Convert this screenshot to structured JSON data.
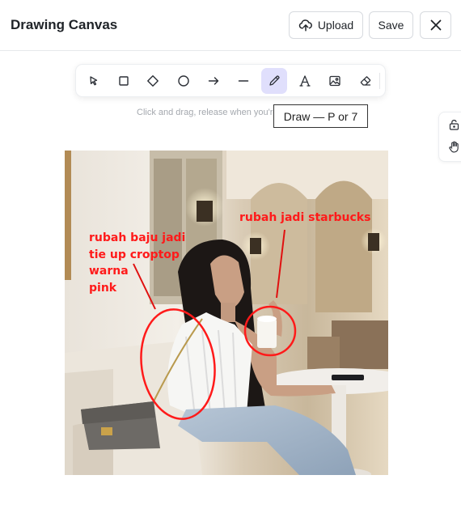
{
  "header": {
    "title": "Drawing Canvas",
    "upload_label": "Upload",
    "save_label": "Save",
    "close_icon": "close-icon"
  },
  "toolbar": {
    "tools": [
      "selection",
      "rectangle",
      "diamond",
      "ellipse",
      "arrow",
      "line",
      "draw",
      "text",
      "image",
      "eraser"
    ],
    "active_tool": "draw",
    "active_color": "#e0dffc"
  },
  "hint": "Click and drag, release when you're finished",
  "tooltip": "Draw — P or 7",
  "side_controls": [
    "lock-icon",
    "hand-icon"
  ],
  "canvas": {
    "annotation_color": "#ff1a1a",
    "annotations": [
      {
        "lines": [
          "rubah baju  jadi",
          "tie up croptop",
          "warna",
          "pink"
        ]
      },
      {
        "lines": [
          "rubah jadi starbucks"
        ]
      }
    ]
  }
}
